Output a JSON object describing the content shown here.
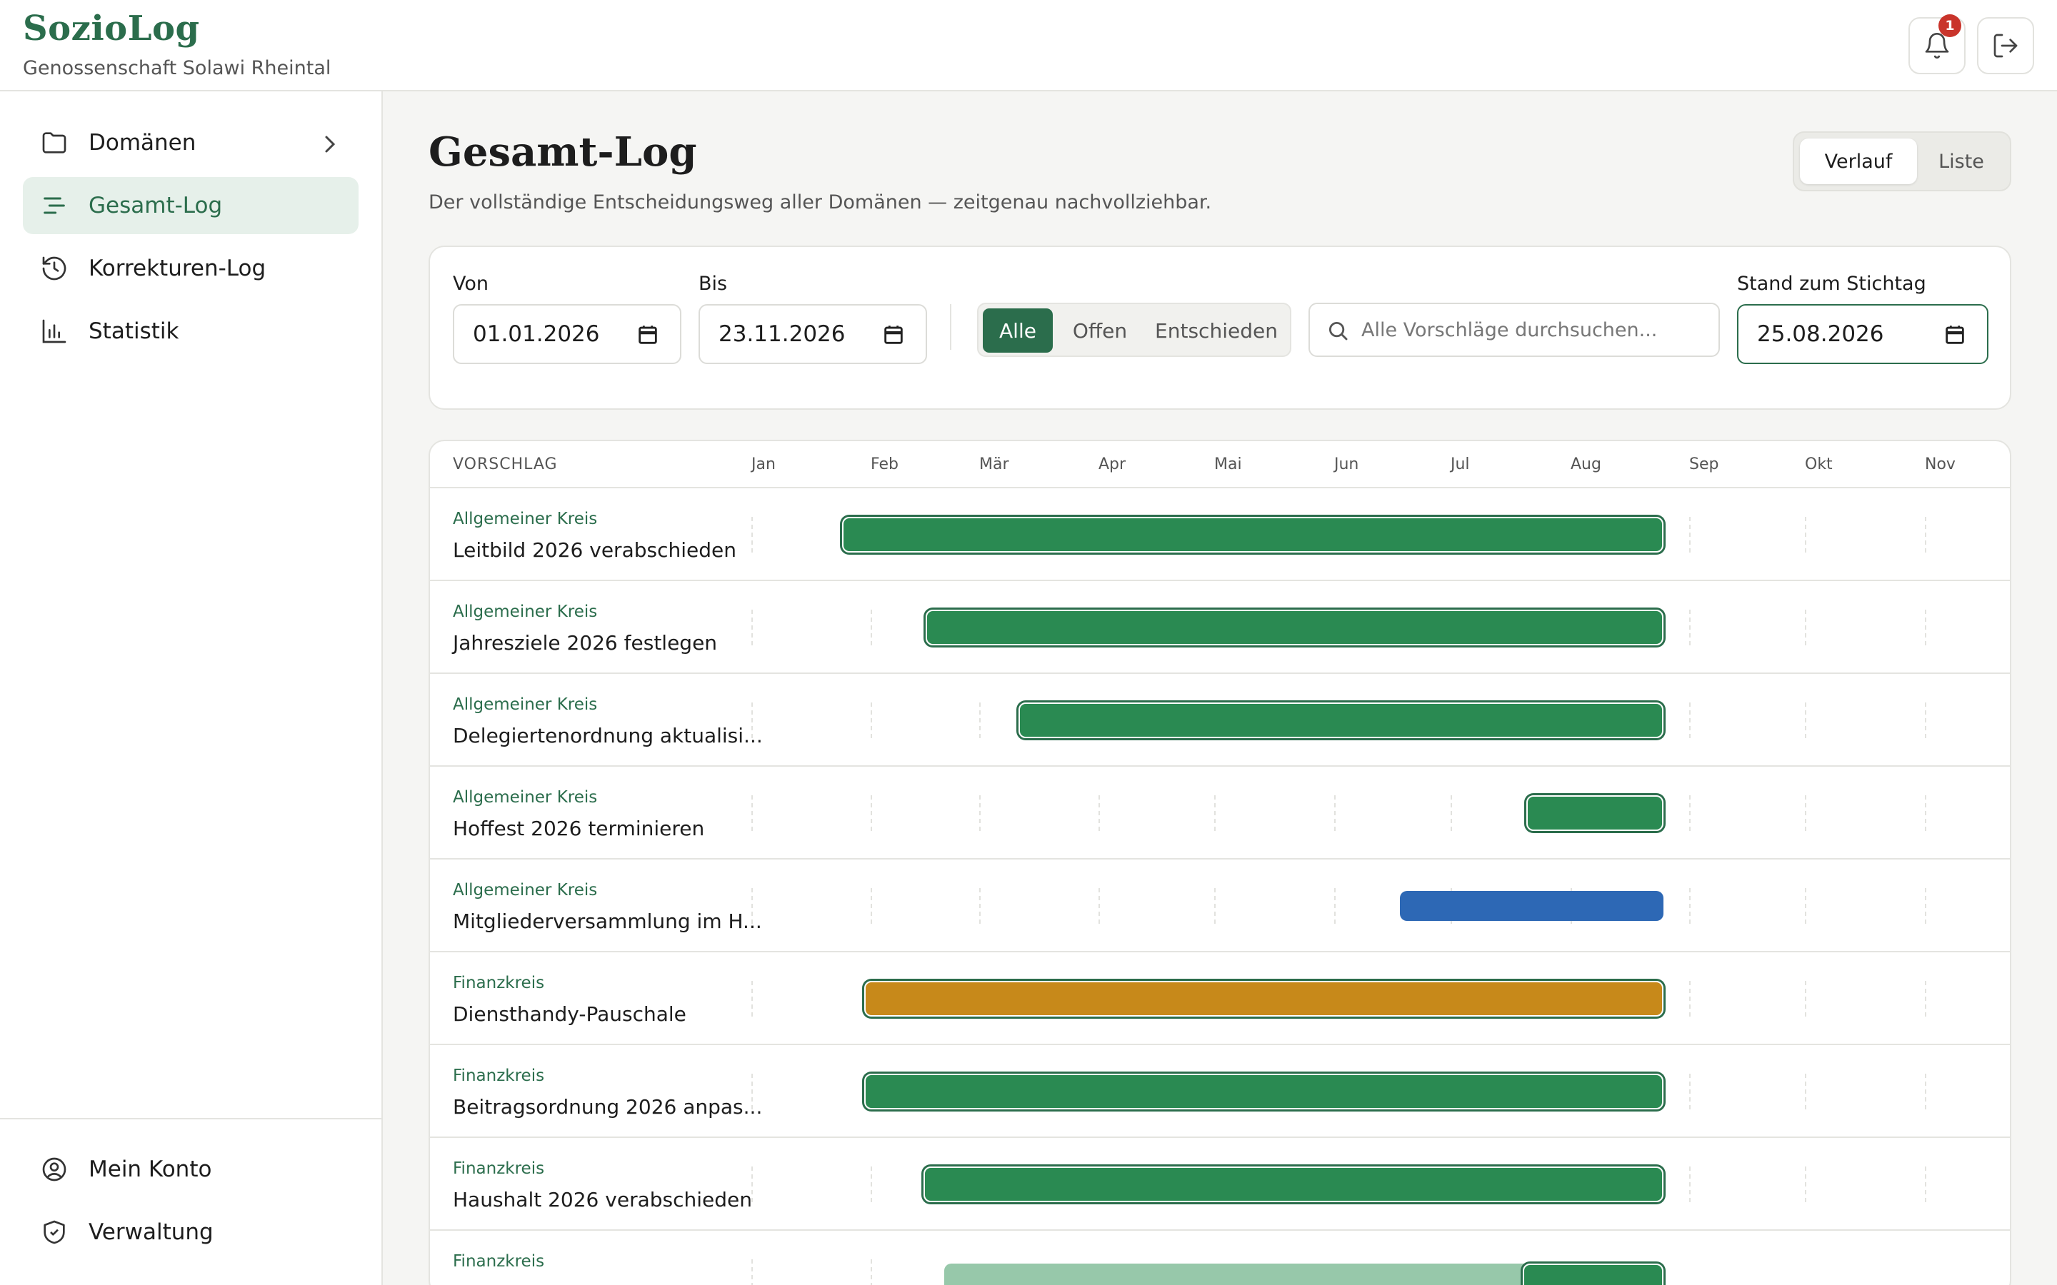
{
  "header": {
    "app_name": "SozioLog",
    "organization": "Genossenschaft Solawi Rheintal",
    "notification_count": "1"
  },
  "sidebar": {
    "items": [
      {
        "label": "Domänen",
        "icon": "folder-icon"
      },
      {
        "label": "Gesamt-Log",
        "icon": "list-icon"
      },
      {
        "label": "Korrekturen-Log",
        "icon": "history-icon"
      },
      {
        "label": "Statistik",
        "icon": "chart-icon"
      }
    ],
    "bottom_items": [
      {
        "label": "Mein Konto",
        "icon": "user-circle-icon"
      },
      {
        "label": "Verwaltung",
        "icon": "shield-icon"
      }
    ]
  },
  "page": {
    "title": "Gesamt-Log",
    "subtitle": "Der vollständige Entscheidungsweg aller Domänen — zeitgenau nachvollziehbar.",
    "view_toggle": {
      "active": "Verlauf",
      "options": [
        "Verlauf",
        "Liste"
      ]
    }
  },
  "filters": {
    "from_label": "Von",
    "from_value": "01.01.2026",
    "to_label": "Bis",
    "to_value": "23.11.2026",
    "status_options": [
      "Alle",
      "Offen",
      "Entschieden"
    ],
    "status_active": "Alle",
    "search_placeholder": "Alle Vorschläge durchsuchen...",
    "stichtag_label": "Stand zum Stichtag",
    "stichtag_value": "25.08.2026"
  },
  "timeline": {
    "column_header": "VORSCHLAG",
    "months": [
      "Jan",
      "Feb",
      "Mär",
      "Apr",
      "Mai",
      "Jun",
      "Jul",
      "Aug",
      "Sep",
      "Okt",
      "Nov"
    ],
    "status_colors": {
      "entschieden": "#2a8a52",
      "offen": "#2d68b5",
      "korrektur": "#c7891a",
      "frueher": "#97c8aa"
    },
    "rows": [
      {
        "domain": "Allgemeiner Kreis",
        "title": "Leitbild 2026 verabschieden"
      },
      {
        "domain": "Allgemeiner Kreis",
        "title": "Jahresziele 2026 festlegen"
      },
      {
        "domain": "Allgemeiner Kreis",
        "title": "Delegiertenordnung aktualisi..."
      },
      {
        "domain": "Allgemeiner Kreis",
        "title": "Hoffest 2026 terminieren"
      },
      {
        "domain": "Allgemeiner Kreis",
        "title": "Mitgliederversammlung im H..."
      },
      {
        "domain": "Finanzkreis",
        "title": "Diensthandy-Pauschale"
      },
      {
        "domain": "Finanzkreis",
        "title": "Beitragsordnung 2026 anpas..."
      },
      {
        "domain": "Finanzkreis",
        "title": "Haushalt 2026 verabschieden"
      },
      {
        "domain": "Finanzkreis",
        "title": ""
      }
    ]
  }
}
